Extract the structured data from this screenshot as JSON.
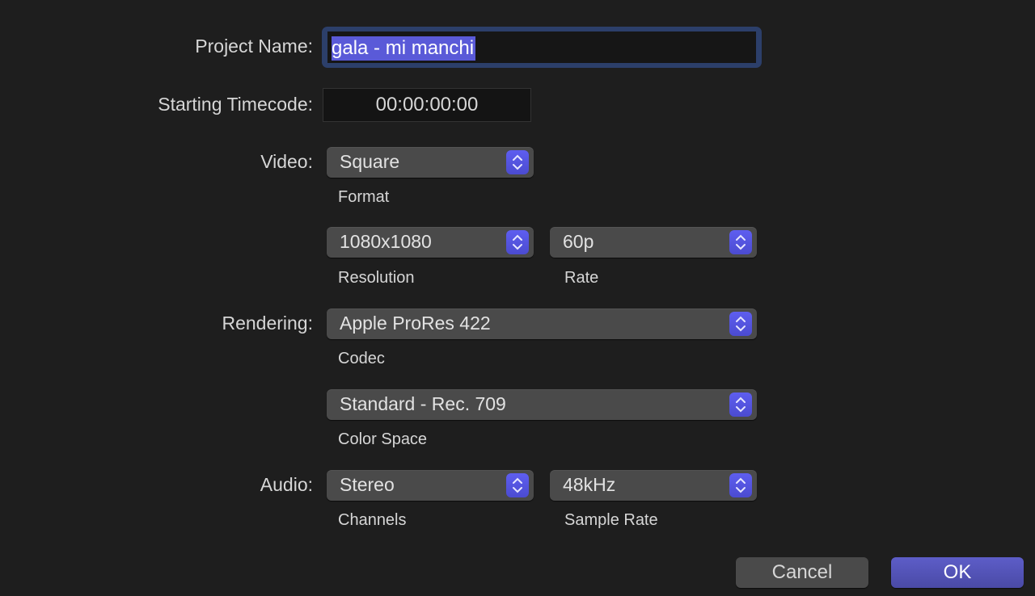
{
  "labels": {
    "project_name": "Project Name:",
    "starting_timecode": "Starting Timecode:",
    "video": "Video:",
    "rendering": "Rendering:",
    "audio": "Audio:"
  },
  "project_name": {
    "value": "gala - mi manchi",
    "selected": true
  },
  "starting_timecode": "00:00:00:00",
  "video": {
    "format": {
      "value": "Square",
      "caption": "Format"
    },
    "resolution": {
      "value": "1080x1080",
      "caption": "Resolution"
    },
    "rate": {
      "value": "60p",
      "caption": "Rate"
    }
  },
  "rendering": {
    "codec": {
      "value": "Apple ProRes 422",
      "caption": "Codec"
    },
    "color_space": {
      "value": "Standard - Rec. 709",
      "caption": "Color Space"
    }
  },
  "audio": {
    "channels": {
      "value": "Stereo",
      "caption": "Channels"
    },
    "sample_rate": {
      "value": "48kHz",
      "caption": "Sample Rate"
    }
  },
  "buttons": {
    "cancel": "Cancel",
    "ok": "OK"
  },
  "colors": {
    "accent": "#5b5bdf",
    "selection": "#5a5ad8",
    "focus_ring": "#2c3f6a",
    "background": "#1e1e1e"
  }
}
